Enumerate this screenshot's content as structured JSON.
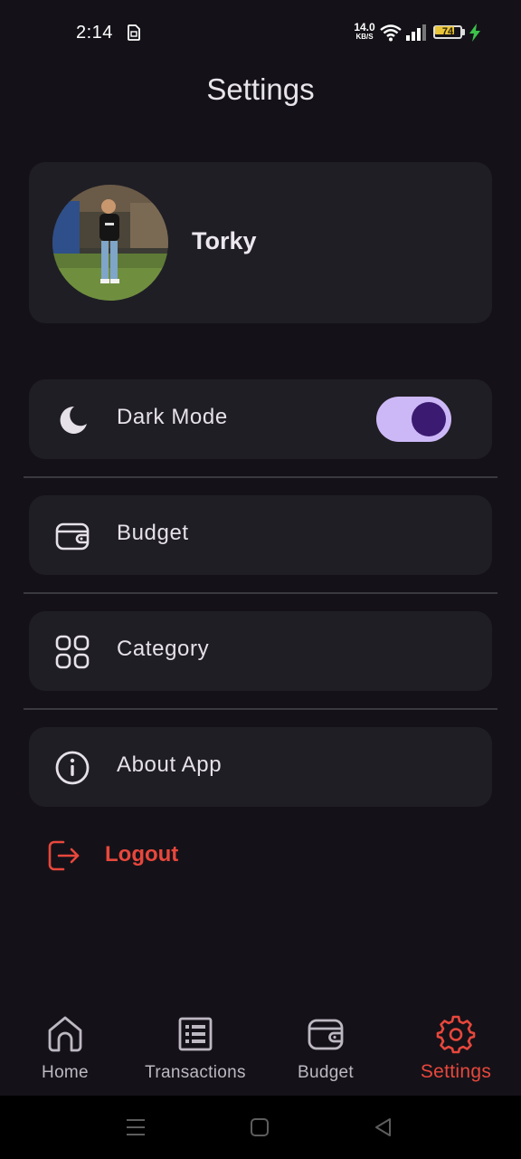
{
  "status_bar": {
    "time": "2:14",
    "net_speed_value": "14.0",
    "net_speed_unit": "KB/S",
    "battery_level": "74",
    "battery_fraction": 0.74,
    "battery_color": "#e9c53a",
    "charging_color": "#3cc24a"
  },
  "header": {
    "title": "Settings"
  },
  "profile": {
    "name": "Torky",
    "avatar_icon": "profile-photo"
  },
  "settings_items": {
    "dark_mode": {
      "label": "Dark Mode",
      "icon": "moon-icon",
      "toggle_on": true
    },
    "budget": {
      "label": "Budget",
      "icon": "wallet-icon"
    },
    "category": {
      "label": "Category",
      "icon": "category-grid-icon"
    },
    "about": {
      "label": "About App",
      "icon": "info-icon"
    }
  },
  "logout": {
    "label": "Logout",
    "color": "#e8473c"
  },
  "bottom_nav": {
    "items": [
      {
        "label": "Home",
        "icon": "home-icon",
        "active": false
      },
      {
        "label": "Transactions",
        "icon": "list-icon",
        "active": false
      },
      {
        "label": "Budget",
        "icon": "wallet-icon",
        "active": false
      },
      {
        "label": "Settings",
        "icon": "gear-icon",
        "active": true
      }
    ],
    "active_color": "#e8473c"
  },
  "theme": {
    "background": "#141218",
    "card": "#1f1e24",
    "toggle_track": "#cdb8f7",
    "toggle_knob": "#3b1b71"
  }
}
